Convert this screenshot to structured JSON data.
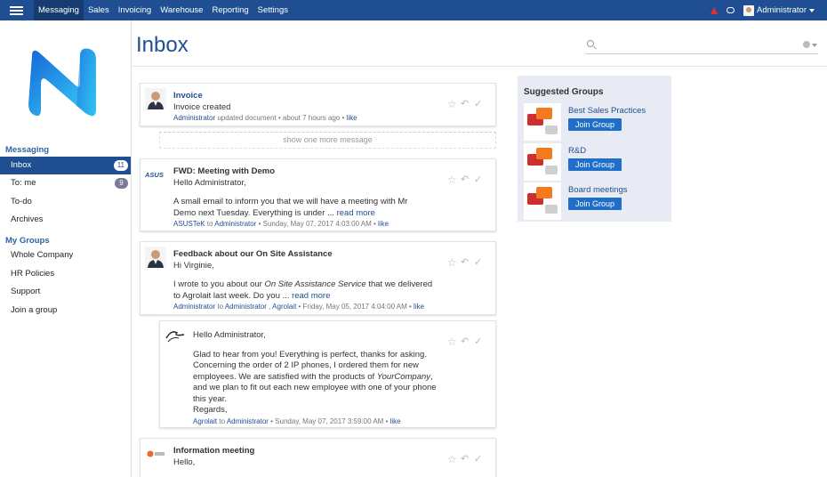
{
  "topbar": {
    "menu": [
      "Messaging",
      "Sales",
      "Invoicing",
      "Warehouse",
      "Reporting",
      "Settings"
    ],
    "active": "Messaging",
    "user": "Administrator",
    "icons": [
      "hamburger-icon",
      "bell-icon",
      "chat-icon",
      "caret-down-icon"
    ]
  },
  "sidebar": {
    "section_messaging": "Messaging",
    "items": [
      {
        "label": "Inbox",
        "count": "11"
      },
      {
        "label": "To: me",
        "count": "9"
      },
      {
        "label": "To-do"
      },
      {
        "label": "Archives"
      }
    ],
    "section_groups": "My Groups",
    "groups": [
      "Whole Company",
      "HR Policies",
      "Support",
      "Join a group"
    ]
  },
  "main": {
    "title": "Inbox",
    "search_placeholder": "",
    "show_more": "show one more message"
  },
  "messages": [
    {
      "title": "Invoice",
      "line1": "Invoice created",
      "author": "Administrator",
      "meta_text": " updated document • about 7 hours ago • ",
      "like": "like"
    },
    {
      "title": "FWD: Meeting with Demo",
      "line1": "Hello Administrator,",
      "line2": "A small email to inform you that we will have a meeting with Mr",
      "line3": "Demo next Tuesday. Everything is under ... ",
      "read_more": "read more",
      "author": "ASUSTeK",
      "to": " to ",
      "recipient": "Administrator",
      "date": " • Sunday, May 07, 2017 4:03:00 AM • ",
      "like": "like"
    },
    {
      "title": "Feedback about our On Site Assistance",
      "line1": "Hi Virginie,",
      "line2a": "I wrote to you about our ",
      "line2b": "On Site Assistance Service",
      "line2c": " that we delivered",
      "line3": "to Agrolait last week. Do you ... ",
      "read_more": "read more",
      "author": "Administrator",
      "to": " to ",
      "recipient": "Administrator",
      "sep": " , ",
      "recipient2": "Agrolait",
      "date": " • Friday, May 05, 2017 4:04:00 AM • ",
      "like": "like"
    },
    {
      "line1": "Hello Administrator,",
      "line2": "Glad to hear from you! Everything is perfect, thanks for asking.",
      "line3": "Concerning the order of 2 IP phones, I ordered them for new",
      "line4a": "employees. We are satisfied with the products of ",
      "line4b": "YourCompany",
      "line4c": ",",
      "line5": "and we plan to fit out each new employee with one of your phone",
      "line6": "this year.",
      "line7": "Regards,",
      "author": "Agrolait",
      "to": " to ",
      "recipient": "Administrator",
      "date": " • Sunday, May 07, 2017 3:59:00 AM • ",
      "like": "like"
    },
    {
      "title": "Information meeting",
      "line1": "Hello,"
    }
  ],
  "suggested": {
    "header": "Suggested Groups",
    "groups": [
      {
        "name": "Best Sales Practices",
        "button": "Join Group"
      },
      {
        "name": "R&D",
        "button": "Join Group"
      },
      {
        "name": "Board meetings",
        "button": "Join Group"
      }
    ]
  },
  "colors": {
    "topbar": "#1f4f92",
    "accent": "#1f4f92",
    "button": "#1f6fc8",
    "panel": "#e8eaf4"
  }
}
